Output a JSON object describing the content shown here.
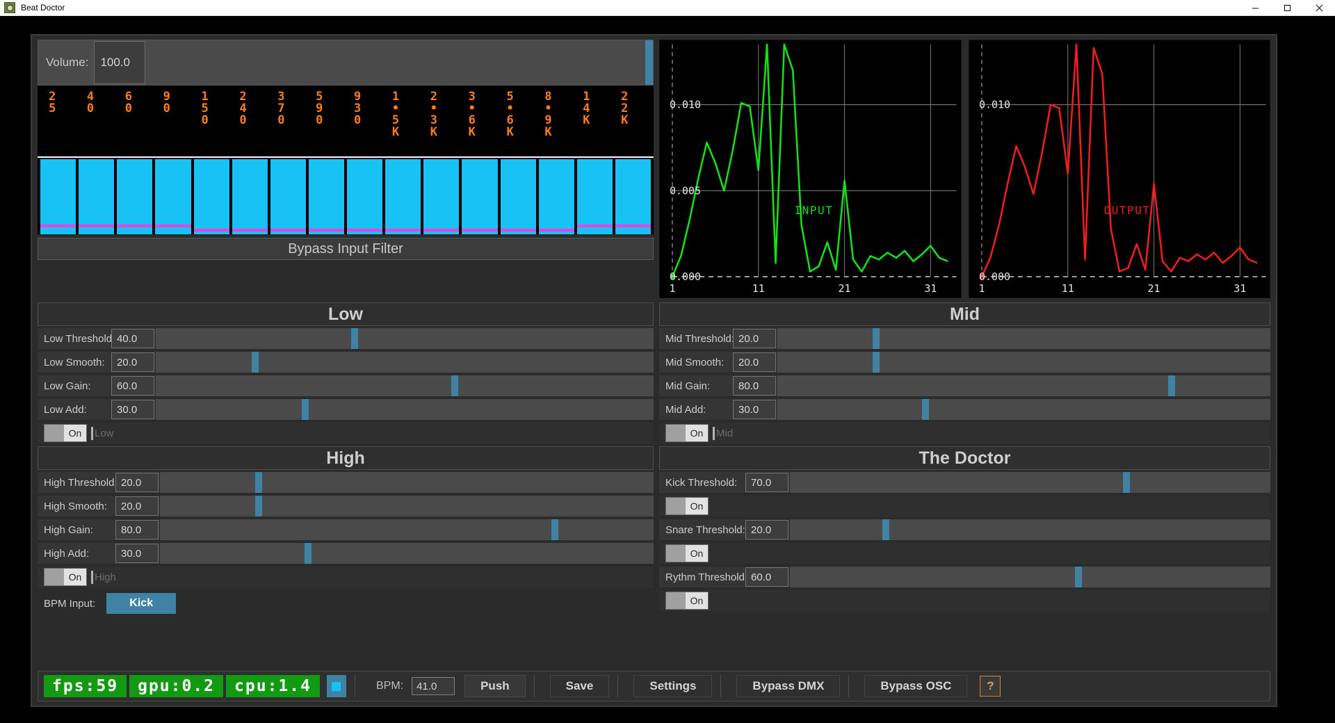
{
  "window": {
    "title": "Beat Doctor",
    "icon": "app-icon",
    "minimize": "─",
    "maximize": "❐",
    "close": "✕"
  },
  "volume": {
    "label": "Volume:",
    "value": "100.0",
    "thumb_pct": 98.5
  },
  "spectrum": {
    "frequency_labels": [
      "25",
      "40",
      "60",
      "90",
      "150",
      "240",
      "370",
      "590",
      "930",
      "1.5K",
      "2.3K",
      "3.6K",
      "5.6K",
      "8.9K",
      "14K",
      "22K"
    ],
    "bar_levels": [
      100,
      100,
      100,
      100,
      100,
      100,
      100,
      100,
      100,
      100,
      100,
      100,
      100,
      100,
      100,
      100
    ],
    "marker_levels": [
      9,
      9,
      9,
      9,
      4,
      4,
      4,
      4,
      4,
      4,
      4,
      4,
      4,
      4,
      9,
      9
    ],
    "bar_color": "#19c2f5",
    "marker_color": "#ef3fe0",
    "label_color": "#ff7e1a"
  },
  "bypass_input_filter": {
    "label": "Bypass Input Filter"
  },
  "chart_data": [
    {
      "type": "line",
      "title": "INPUT",
      "color": "#15e015",
      "ylabel": "",
      "xlabel": "",
      "ytick_labels": [
        "0.000",
        "0.005",
        "0.010"
      ],
      "ytick_values": [
        0.0,
        0.005,
        0.01
      ],
      "xtick_labels": [
        "1",
        "11",
        "21",
        "31"
      ],
      "xtick_values": [
        1,
        11,
        21,
        31
      ],
      "ylim": [
        0.0,
        0.0135
      ],
      "xlim": [
        1,
        34
      ],
      "grid": true,
      "x": [
        1,
        2,
        3,
        4,
        5,
        6,
        7,
        8,
        9,
        10,
        11,
        12,
        13,
        14,
        15,
        16,
        17,
        18,
        19,
        20,
        21,
        22,
        23,
        24,
        25,
        26,
        27,
        28,
        29,
        30,
        31,
        32,
        33
      ],
      "values": [
        0.0,
        0.0012,
        0.0033,
        0.0057,
        0.0078,
        0.0066,
        0.005,
        0.0073,
        0.0101,
        0.0099,
        0.0062,
        0.0135,
        0.0008,
        0.0135,
        0.012,
        0.003,
        0.0003,
        0.0006,
        0.002,
        0.0004,
        0.0056,
        0.001,
        0.0003,
        0.0012,
        0.001,
        0.0014,
        0.0011,
        0.0015,
        0.0009,
        0.0013,
        0.0018,
        0.0011,
        0.0009
      ]
    },
    {
      "type": "line",
      "title": "OUTPUT",
      "color": "#ef1d1d",
      "ylabel": "",
      "xlabel": "",
      "ytick_labels": [
        "0.000",
        "0.010"
      ],
      "ytick_values": [
        0.0,
        0.01
      ],
      "xtick_labels": [
        "1",
        "11",
        "21",
        "31"
      ],
      "xtick_values": [
        1,
        11,
        21,
        31
      ],
      "ylim": [
        0.0,
        0.0135
      ],
      "xlim": [
        1,
        34
      ],
      "grid": true,
      "x": [
        1,
        2,
        3,
        4,
        5,
        6,
        7,
        8,
        9,
        10,
        11,
        12,
        13,
        14,
        15,
        16,
        17,
        18,
        19,
        20,
        21,
        22,
        23,
        24,
        25,
        26,
        27,
        28,
        29,
        30,
        31,
        32,
        33
      ],
      "values": [
        0.0,
        0.0011,
        0.003,
        0.0054,
        0.0076,
        0.0064,
        0.0048,
        0.0072,
        0.01,
        0.0098,
        0.006,
        0.0135,
        0.001,
        0.0133,
        0.0118,
        0.0028,
        0.0003,
        0.0005,
        0.0019,
        0.0004,
        0.0054,
        0.0009,
        0.0003,
        0.0011,
        0.0009,
        0.0013,
        0.001,
        0.0014,
        0.0008,
        0.0012,
        0.0017,
        0.001,
        0.0008
      ]
    }
  ],
  "sections": {
    "low": {
      "title": "Low",
      "controls": [
        {
          "label": "Low Threshold:",
          "value": "40.0",
          "pct": 40.0
        },
        {
          "label": "Low Smooth:",
          "value": "20.0",
          "pct": 20.0
        },
        {
          "label": "Low Gain:",
          "value": "60.0",
          "pct": 60.0
        },
        {
          "label": "Low Add:",
          "value": "30.0",
          "pct": 30.0
        }
      ],
      "toggle": {
        "label": "On",
        "state": "on"
      },
      "name_placeholder": "Low"
    },
    "mid": {
      "title": "Mid",
      "controls": [
        {
          "label": "Mid Threshold:",
          "value": "20.0",
          "pct": 20.0
        },
        {
          "label": "Mid Smooth:",
          "value": "20.0",
          "pct": 20.0
        },
        {
          "label": "Mid Gain:",
          "value": "80.0",
          "pct": 80.0
        },
        {
          "label": "Mid Add:",
          "value": "30.0",
          "pct": 30.0
        }
      ],
      "toggle": {
        "label": "On",
        "state": "on"
      },
      "name_placeholder": "Mid"
    },
    "high": {
      "title": "High",
      "controls": [
        {
          "label": "High Threshold:",
          "value": "20.0",
          "pct": 20.0
        },
        {
          "label": "High Smooth:",
          "value": "20.0",
          "pct": 20.0
        },
        {
          "label": "High Gain:",
          "value": "80.0",
          "pct": 80.0
        },
        {
          "label": "High Add:",
          "value": "30.0",
          "pct": 30.0
        }
      ],
      "toggle": {
        "label": "On",
        "state": "on"
      },
      "name_placeholder": "High",
      "bpm_input": {
        "label": "BPM Input:",
        "button": "Kick"
      }
    },
    "doctor": {
      "title": "The Doctor",
      "kick": {
        "label": "Kick Threshold:",
        "value": "70.0",
        "pct": 70.0,
        "toggle": "On"
      },
      "snare": {
        "label": "Snare Threshold:",
        "value": "20.0",
        "pct": 20.0,
        "toggle": "On"
      },
      "rythm": {
        "label": "Rythm Threshold:",
        "value": "60.0",
        "pct": 60.0,
        "toggle": "On"
      }
    }
  },
  "statusbar": {
    "fps": "fps:59",
    "gpu": "gpu:0.2",
    "cpu": "cpu:1.4",
    "bpm_label": "BPM:",
    "bpm_value": "41.0",
    "push": "Push",
    "save": "Save",
    "settings": "Settings",
    "bypass_dmx": "Bypass DMX",
    "bypass_osc": "Bypass OSC",
    "help": "?",
    "stat_color": "#139a13",
    "accent_color": "#3f82a3"
  }
}
